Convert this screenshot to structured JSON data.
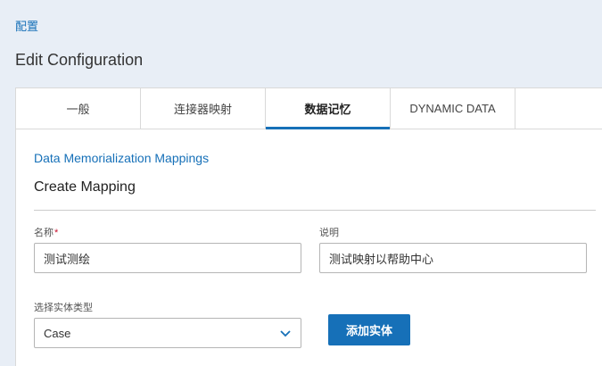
{
  "breadcrumb": {
    "label": "配置"
  },
  "page": {
    "title": "Edit Configuration"
  },
  "tabs": [
    {
      "label": "一般",
      "active": false
    },
    {
      "label": "连接器映射",
      "active": false
    },
    {
      "label": "数据记忆",
      "active": true
    },
    {
      "label": "DYNAMIC DATA",
      "active": false
    }
  ],
  "section": {
    "link": "Data Memorialization Mappings",
    "title": "Create Mapping"
  },
  "form": {
    "name": {
      "label": "名称",
      "required_mark": "*",
      "value": "测试测绘"
    },
    "description": {
      "label": "说明",
      "value": "测试映射以帮助中心"
    },
    "entity_type": {
      "label": "选择实体类型",
      "selected": "Case",
      "icon": "chevron-down-icon"
    },
    "add_entity_button": "添加实体"
  },
  "colors": {
    "accent": "#1670b8",
    "required": "#c8102e",
    "header_bg": "#e8eef6"
  }
}
